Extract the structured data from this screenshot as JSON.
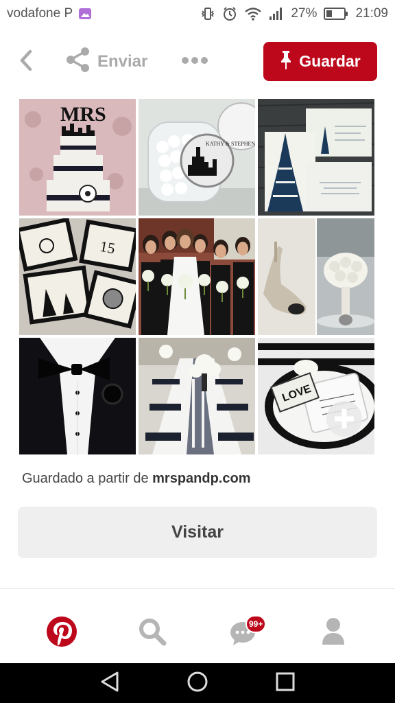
{
  "status": {
    "carrier": "vodafone P",
    "battery": "27%",
    "time": "21:09"
  },
  "toolbar": {
    "share_label": "Enviar",
    "save_label": "Guardar"
  },
  "pin": {
    "saved_from_prefix": "Guardado a partir de",
    "saved_from_domain": "mrspandp.com",
    "image_text": {
      "cake_topper": "MRS",
      "jar_label": "KATHY & STEPHEN",
      "tag_text": "LOVE"
    },
    "visit_label": "Visitar"
  },
  "nav": {
    "notifications_badge": "99+"
  },
  "colors": {
    "brand": "#bd081c",
    "visit_bg": "#efefef",
    "system_bar": "#000000"
  },
  "icons": [
    "back-icon",
    "share-icon",
    "more-icon",
    "pushpin-icon",
    "pinterest-logo-icon",
    "search-icon",
    "chat-icon",
    "profile-icon",
    "back-triangle-icon",
    "home-circle-icon",
    "recents-square-icon"
  ]
}
